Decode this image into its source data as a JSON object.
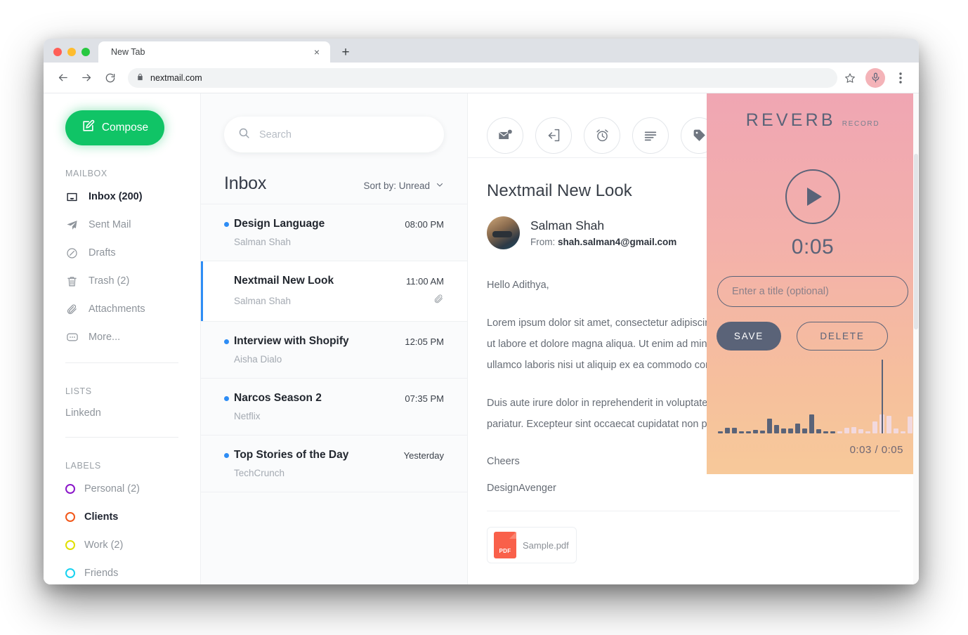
{
  "browser": {
    "tab_title": "New Tab",
    "close_label": "×",
    "newtab_label": "+",
    "url": "nextmail.com",
    "icons": {
      "back": "back-arrow-icon",
      "forward": "forward-arrow-icon",
      "reload": "reload-icon",
      "lock": "lock-icon",
      "star": "star-icon",
      "mic": "microphone-icon",
      "menu": "kebab-menu-icon"
    }
  },
  "sidebar": {
    "compose_label": "Compose",
    "mailbox_heading": "MAILBOX",
    "mailbox_items": [
      {
        "label": "Inbox (200)",
        "icon": "inbox-icon",
        "active": true
      },
      {
        "label": "Sent Mail",
        "icon": "paper-plane-icon",
        "active": false
      },
      {
        "label": "Drafts",
        "icon": "pencil-circle-icon",
        "active": false
      },
      {
        "label": "Trash (2)",
        "icon": "trash-icon",
        "active": false
      },
      {
        "label": "Attachments",
        "icon": "paperclip-icon",
        "active": false
      },
      {
        "label": "More...",
        "icon": "ellipsis-icon",
        "active": false
      }
    ],
    "lists_heading": "LISTS",
    "lists_items": [
      {
        "label": "Linkedn"
      }
    ],
    "labels_heading": "LABELS",
    "labels_items": [
      {
        "label": "Personal (2)",
        "color": "#8b17c9",
        "bold": false
      },
      {
        "label": "Clients",
        "color": "#f2581a",
        "bold": true
      },
      {
        "label": "Work (2)",
        "color": "#e0e000",
        "bold": false
      },
      {
        "label": "Friends",
        "color": "#17d2f0",
        "bold": false
      }
    ]
  },
  "maillist": {
    "search_placeholder": "Search",
    "title": "Inbox",
    "sort_label": "Sort by: Unread",
    "rows": [
      {
        "subject": "Design Language",
        "sender": "Salman Shah",
        "time": "08:00 PM",
        "unread": true,
        "selected": false,
        "attachment": false
      },
      {
        "subject": "Nextmail New Look",
        "sender": "Salman Shah",
        "time": "11:00 AM",
        "unread": false,
        "selected": true,
        "attachment": true
      },
      {
        "subject": "Interview with Shopify",
        "sender": "Aisha Dialo",
        "time": "12:05 PM",
        "unread": true,
        "selected": false,
        "attachment": false
      },
      {
        "subject": "Narcos Season 2",
        "sender": "Netflix",
        "time": "07:35 PM",
        "unread": true,
        "selected": false,
        "attachment": false
      },
      {
        "subject": "Top Stories of the Day",
        "sender": "TechCrunch",
        "time": "Yesterday",
        "unread": true,
        "selected": false,
        "attachment": false
      }
    ]
  },
  "reader": {
    "toolbar_icons": [
      "mark-unread-envelope-icon",
      "archive-icon",
      "snooze-clock-icon",
      "summary-lines-icon",
      "label-tag-icon"
    ],
    "subject": "Nextmail New Look",
    "sender_name": "Salman Shah",
    "from_label": "From:",
    "sender_email": "shah.salman4@gmail.com",
    "greeting": "Hello Adithya,",
    "paragraph1": "Lorem ipsum dolor sit amet, consectetur adipiscing elit, sed do eiusmod tempor incididunt ut labore et dolore magna aliqua. Ut enim ad minim veniam, quis nostrud exercitation ullamco laboris nisi ut aliquip ex ea commodo consequat.",
    "paragraph2": "Duis aute irure dolor in reprehenderit in voluptate velit esse cillum dolore eu fugiat nulla pariatur. Excepteur sint occaecat cupidatat non proident.",
    "signoff": "Cheers",
    "signature": "DesignAvenger",
    "attachment": {
      "type": "PDF",
      "name": "Sample.pdf"
    }
  },
  "reverb": {
    "logo": "REVERB",
    "subtitle": "RECORD",
    "play_icon": "play-icon",
    "duration": "0:05",
    "title_placeholder": "Enter a title (optional)",
    "save_label": "SAVE",
    "delete_label": "DELETE",
    "progress": "0:03 / 0:05",
    "accent": "#5a6378",
    "gradient_top": "#f0a6b3",
    "gradient_bottom": "#f7c99a",
    "waveform": {
      "played_count": 17,
      "heights": [
        3,
        8,
        8,
        3,
        3,
        5,
        4,
        21,
        12,
        7,
        7,
        14,
        7,
        27,
        6,
        3,
        3,
        3,
        8,
        9,
        6,
        3,
        17,
        27,
        25,
        7,
        3,
        24,
        39,
        13,
        21,
        9,
        18,
        12,
        8,
        17,
        10,
        13,
        19,
        6
      ],
      "playhead_index": 23
    }
  }
}
